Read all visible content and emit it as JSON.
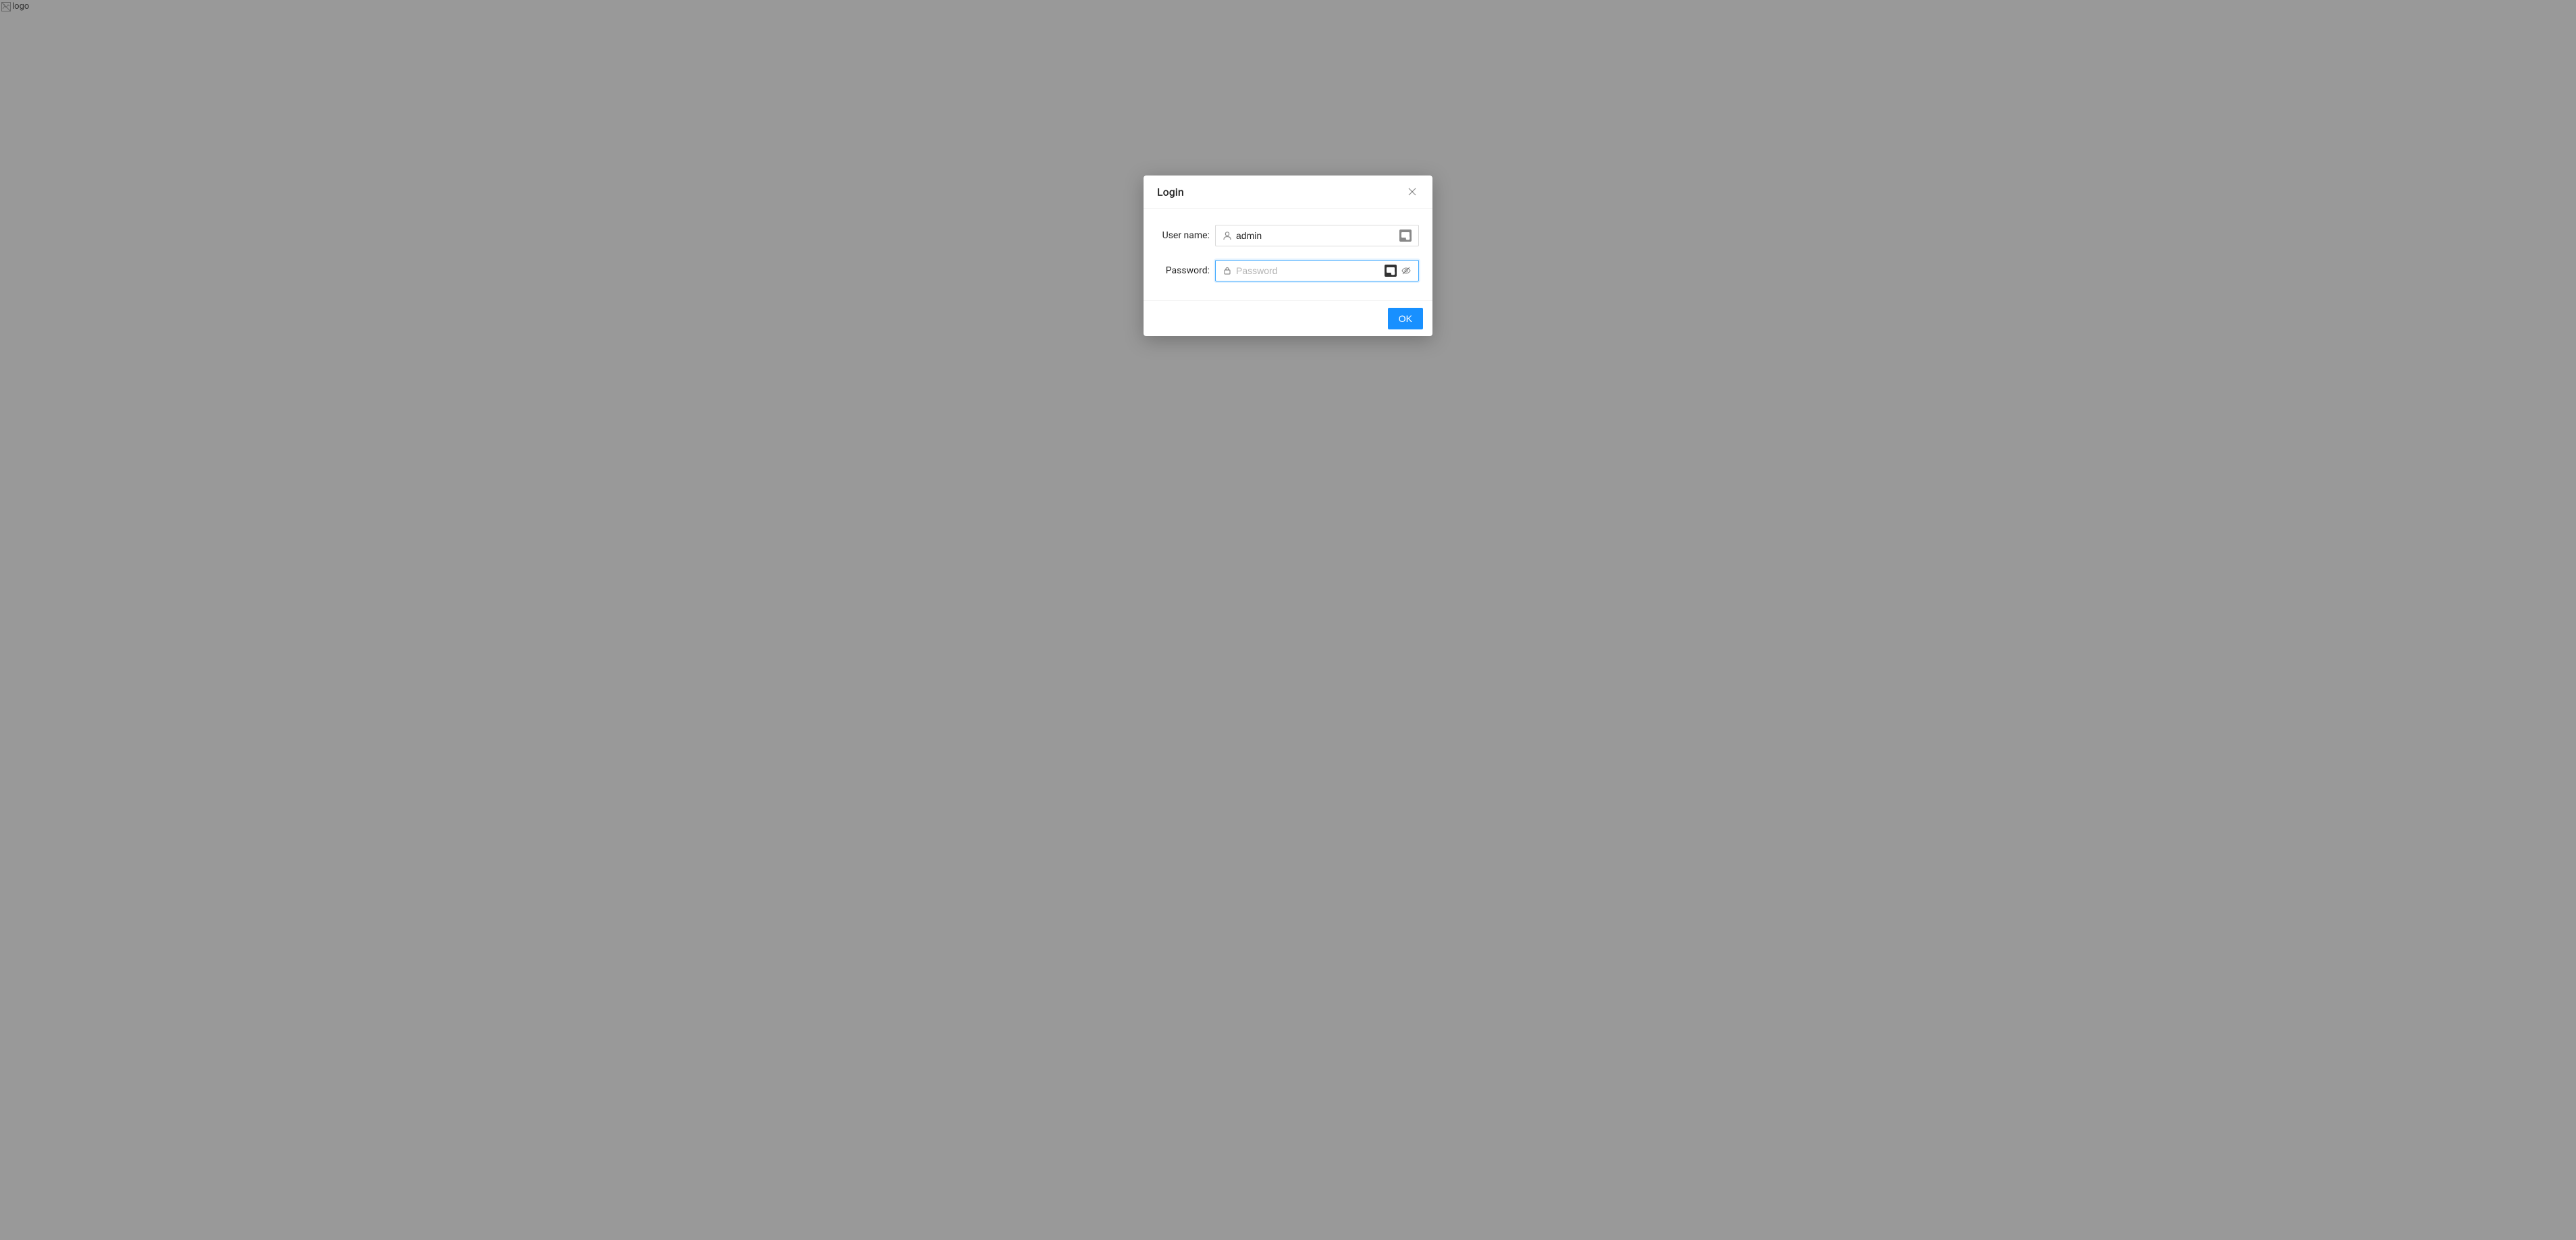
{
  "logo": {
    "alt_text": "logo"
  },
  "modal": {
    "title": "Login",
    "form": {
      "username_label": "User name:",
      "username_value": "admin",
      "password_label": "Password:",
      "password_placeholder": "Password",
      "password_value": ""
    },
    "footer": {
      "ok_label": "OK"
    }
  }
}
